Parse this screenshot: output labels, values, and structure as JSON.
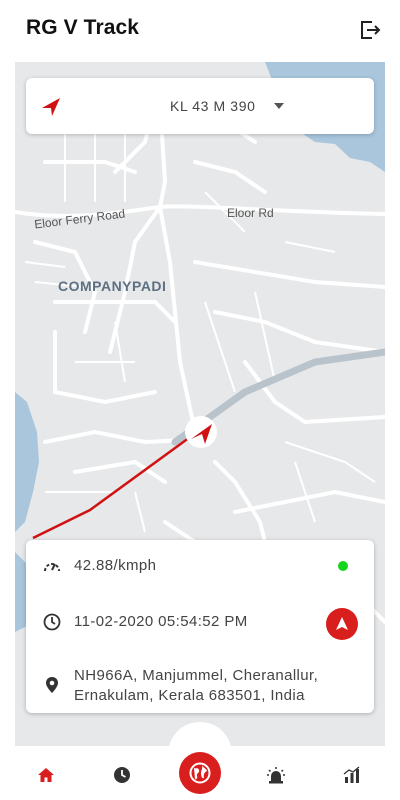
{
  "app": {
    "title": "RG V Track"
  },
  "vehicle": {
    "selected": "KL 43 M 390"
  },
  "map": {
    "labels": {
      "eloor_ferry_road": "Eloor Ferry Road",
      "eloor_rd": "Eloor Rd",
      "area": "COMPANYPADI"
    }
  },
  "info": {
    "speed": "42.88/kmph",
    "datetime": "11-02-2020  05:54:52 PM",
    "address": "NH966A, Manjummel, Cheranallur, Ernakulam, Kerala 683501, India",
    "status_color": "#16d31b"
  },
  "nav": {
    "items": [
      "home-icon",
      "history-icon",
      "globe-icon",
      "alarm-icon",
      "reports-icon"
    ],
    "active": "home-icon"
  },
  "colors": {
    "accent": "#d91e1e",
    "route": "#d01212",
    "water": "#a9c6dd"
  }
}
